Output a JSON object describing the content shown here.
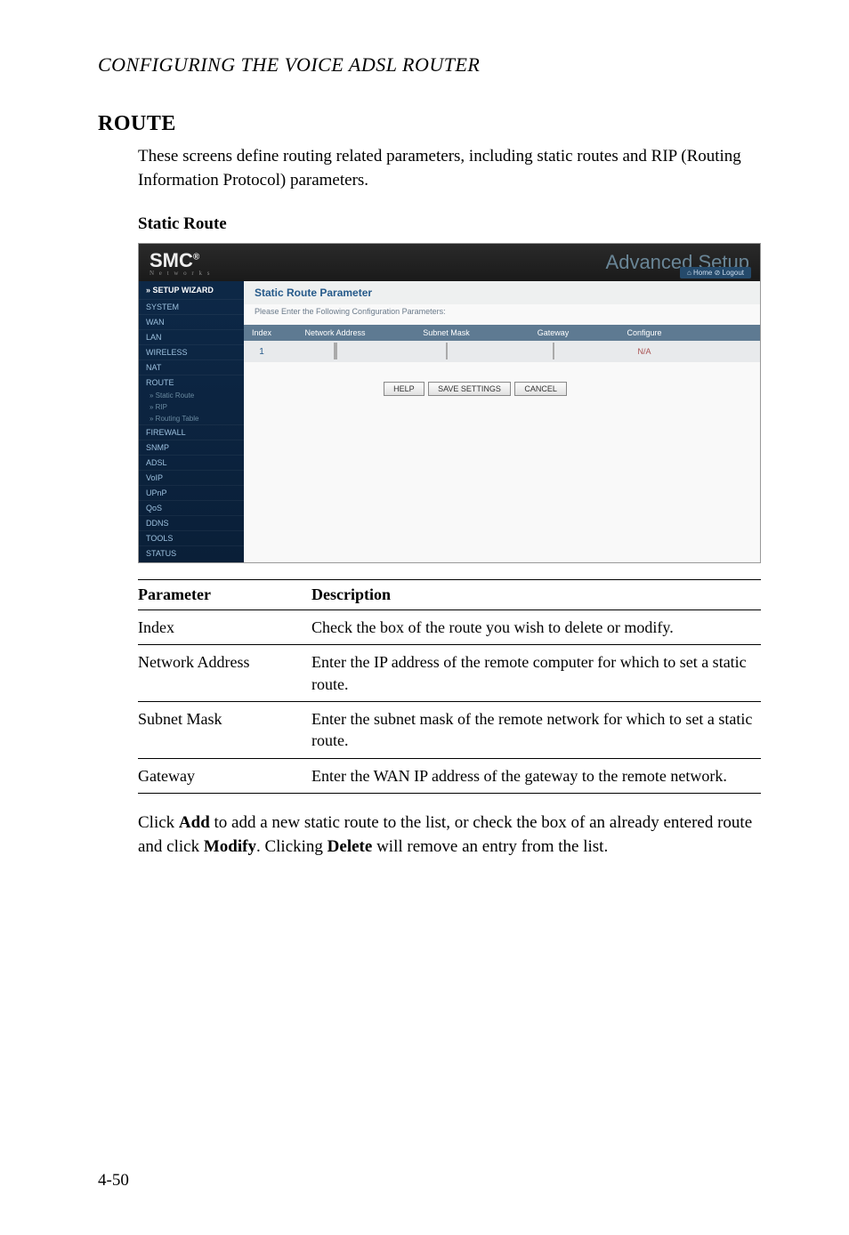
{
  "header_italic": "CONFIGURING THE VOICE ADSL ROUTER",
  "section_title": "ROUTE",
  "intro_text": "These screens define routing related parameters, including static routes and RIP (Routing Information Protocol) parameters.",
  "subsection_title": "Static Route",
  "screenshot": {
    "logo": "SMC",
    "logo_reg": "®",
    "logo_sub": "N e t w o r k s",
    "adv_text": "Advanced Setup",
    "top_home": "Home",
    "top_logout": "Logout",
    "sidebar": {
      "setup_wizard": "» SETUP WIZARD",
      "items": [
        "SYSTEM",
        "WAN",
        "LAN",
        "WIRELESS",
        "NAT",
        "ROUTE"
      ],
      "subs": [
        "» Static Route",
        "» RIP",
        "» Routing Table"
      ],
      "items2": [
        "FIREWALL",
        "SNMP",
        "ADSL",
        "VoIP",
        "UPnP",
        "QoS",
        "DDNS",
        "TOOLS",
        "STATUS"
      ]
    },
    "main": {
      "title": "Static Route Parameter",
      "subtitle": "Please Enter the Following Configuration Parameters:",
      "cols": {
        "index": "Index",
        "network_address": "Network Address",
        "subnet_mask": "Subnet Mask",
        "gateway": "Gateway",
        "configure": "Configure"
      },
      "row1_index": "1",
      "row1_config": "N/A",
      "buttons": {
        "help": "HELP",
        "save": "SAVE SETTINGS",
        "cancel": "CANCEL"
      }
    }
  },
  "table": {
    "header_param": "Parameter",
    "header_desc": "Description",
    "rows": [
      {
        "param": "Index",
        "desc": "Check the box of the route you wish to delete or modify."
      },
      {
        "param": "Network Address",
        "desc": "Enter the IP address of the remote computer for which to set a static route."
      },
      {
        "param": "Subnet Mask",
        "desc": "Enter the subnet mask of the remote network for which to set a static route."
      },
      {
        "param": "Gateway",
        "desc": "Enter the WAN IP address of the gateway to the remote network."
      }
    ]
  },
  "closing": {
    "pre1": "Click ",
    "b1": "Add",
    "mid1": " to add a new static route to the list, or check the box of an already entered route and click ",
    "b2": "Modify",
    "mid2": ". Clicking ",
    "b3": "Delete",
    "post": " will remove an entry from the list."
  },
  "page_num": "4-50"
}
